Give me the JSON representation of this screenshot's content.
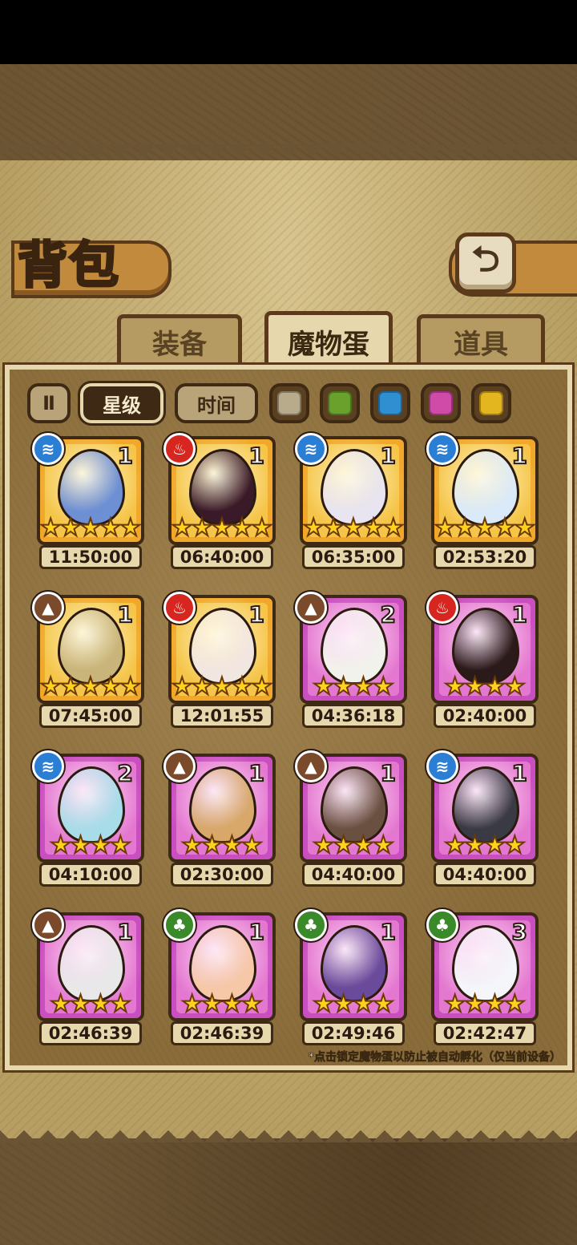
{
  "header": {
    "title": "背包",
    "back_icon": "back-arrow-icon"
  },
  "tabs": [
    {
      "label": "装备",
      "active": false
    },
    {
      "label": "魔物蛋",
      "active": true
    },
    {
      "label": "道具",
      "active": false
    }
  ],
  "filters": {
    "pause_icon": "pause-toggle-icon",
    "sort_star": "星级",
    "sort_time": "时间",
    "swatches": [
      {
        "name": "gray",
        "color": "#b7ab8b"
      },
      {
        "name": "green",
        "color": "#6aa02c"
      },
      {
        "name": "blue",
        "color": "#2f8fd0"
      },
      {
        "name": "pink",
        "color": "#d04aa8"
      },
      {
        "name": "yellow",
        "color": "#e3b51e"
      }
    ]
  },
  "element_colors": {
    "water": "#2a7fd4",
    "fire": "#d7261f",
    "earth": "#7a4a2a",
    "wood": "#3b8a2a"
  },
  "eggs": [
    {
      "element": "water",
      "count": "1",
      "stars": 5,
      "rarity": "gold",
      "timer": "11:50:00",
      "egg_color": "#6d8fd4"
    },
    {
      "element": "fire",
      "count": "1",
      "stars": 5,
      "rarity": "gold",
      "timer": "06:40:00",
      "egg_color": "#3a1a28"
    },
    {
      "element": "water",
      "count": "1",
      "stars": 5,
      "rarity": "gold",
      "timer": "06:35:00",
      "egg_color": "#e8e4f0"
    },
    {
      "element": "water",
      "count": "1",
      "stars": 5,
      "rarity": "gold",
      "timer": "02:53:20",
      "egg_color": "#dbeaf8"
    },
    {
      "element": "earth",
      "count": "1",
      "stars": 5,
      "rarity": "gold",
      "timer": "07:45:00",
      "egg_color": "#c9b57a"
    },
    {
      "element": "fire",
      "count": "1",
      "stars": 5,
      "rarity": "gold",
      "timer": "12:01:55",
      "egg_color": "#f2e6e0"
    },
    {
      "element": "earth",
      "count": "2",
      "stars": 4,
      "rarity": "purple",
      "timer": "04:36:18",
      "egg_color": "#f2f2ec"
    },
    {
      "element": "fire",
      "count": "1",
      "stars": 4,
      "rarity": "purple",
      "timer": "02:40:00",
      "egg_color": "#2a1a1a"
    },
    {
      "element": "water",
      "count": "2",
      "stars": 4,
      "rarity": "purple",
      "timer": "04:10:00",
      "egg_color": "#a8dce8"
    },
    {
      "element": "earth",
      "count": "1",
      "stars": 4,
      "rarity": "purple",
      "timer": "02:30:00",
      "egg_color": "#d7a86a"
    },
    {
      "element": "earth",
      "count": "1",
      "stars": 4,
      "rarity": "purple",
      "timer": "04:40:00",
      "egg_color": "#6a5040"
    },
    {
      "element": "water",
      "count": "1",
      "stars": 4,
      "rarity": "purple",
      "timer": "04:40:00",
      "egg_color": "#3a3a44"
    },
    {
      "element": "earth",
      "count": "1",
      "stars": 4,
      "rarity": "purple",
      "timer": "02:46:39",
      "egg_color": "#e8e8e8"
    },
    {
      "element": "wood",
      "count": "1",
      "stars": 4,
      "rarity": "purple",
      "timer": "02:46:39",
      "egg_color": "#f6c8a8"
    },
    {
      "element": "wood",
      "count": "1",
      "stars": 4,
      "rarity": "purple",
      "timer": "02:49:46",
      "egg_color": "#6a4a9a"
    },
    {
      "element": "wood",
      "count": "3",
      "stars": 4,
      "rarity": "purple",
      "timer": "02:42:47",
      "egg_color": "#f4f6fa"
    }
  ],
  "footer_note": "*点击锁定魔物蛋以防止被自动孵化（仅当前设备）"
}
